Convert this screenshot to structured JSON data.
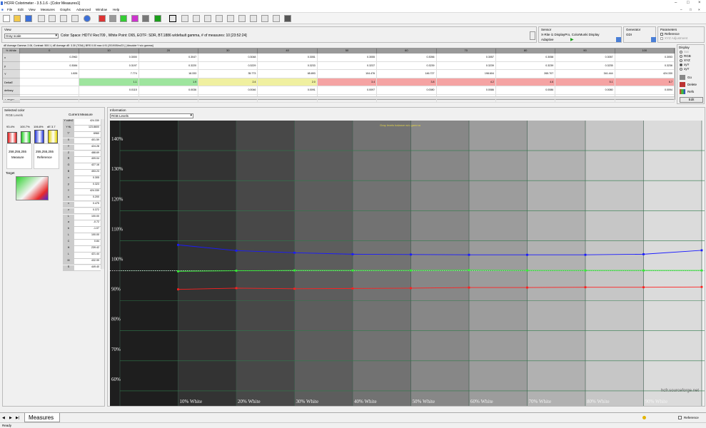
{
  "window": {
    "title": "HCFR Colorimeter - 3.5.1.6 - [Color Measures1]"
  },
  "menu": [
    "File",
    "Edit",
    "View",
    "Measures",
    "Graphs",
    "Advanced",
    "Window",
    "Help"
  ],
  "view": {
    "label": "View",
    "selected": "Gray scale",
    "color_space": "Color Space: HDTV Rec709 , White Point: D65, EOTF:  SDR, BT.1886 w/default gamma, # of measures: 10 [23:52:24]"
  },
  "sensor": {
    "label": "Sensor",
    "line1": "X-Rite i1 DisplayPro, ColorMunki Display",
    "line2": "Adaptive"
  },
  "generator": {
    "label": "Generator",
    "value": "GDI"
  },
  "parameters": {
    "label": "Parameters",
    "reference": "Reference",
    "xyz": "XYZ Adjustment"
  },
  "summary_line": "dE Average Gamma: 2.06, Contrast: 500:1 | dE Average dE: 3.30 (TGM) | BRS 0.00 max 4.91 |2019/05/xx23 | [ Absolute Y w/o gamma]",
  "table": {
    "corner": "% White",
    "columns": [
      "0",
      "10",
      "20",
      "30",
      "40",
      "50",
      "60",
      "70",
      "80",
      "90",
      "100"
    ],
    "rows": [
      {
        "label": "x",
        "values": [
          "",
          "0.2962",
          "0.3000",
          "0.3047",
          "0.3048",
          "0.3051",
          "0.3055",
          "0.3056",
          "0.3057",
          "0.3058",
          "0.3057",
          "0.3053"
        ]
      },
      {
        "label": "y",
        "values": [
          "",
          "0.3084",
          "0.3197",
          "0.3220",
          "0.3229",
          "0.3233",
          "0.3237",
          "0.3239",
          "0.3239",
          "0.3239",
          "0.3235",
          "0.3236"
        ]
      },
      {
        "label": "Y",
        "values": [
          "",
          "1.826",
          "7.774",
          "18.333",
          "35.773",
          "65.893",
          "104.476",
          "146.727",
          "198.604",
          "265.707",
          "341.444",
          "424.330"
        ]
      },
      {
        "label": "DeltaE",
        "values": [
          "",
          "",
          "1.1",
          "1.9",
          "2.4",
          "2.0",
          "3.4",
          "3.8",
          "4.2",
          "4.6",
          "5.1",
          "6.7"
        ]
      },
      {
        "label": "deltaxy",
        "values": [
          "",
          "",
          "0.0115",
          "0.0036",
          "0.0046",
          "0.0091",
          "0.0097",
          "0.0080",
          "0.0086",
          "0.0086",
          "0.0080",
          "0.0094"
        ]
      },
      {
        "label": "Y target",
        "values": [
          "",
          "1.828",
          "8.665",
          "20.865",
          "40.197",
          "67.662",
          "101.386",
          "145.779",
          "199.754",
          "263.610",
          "338.518",
          "424.330"
        ]
      }
    ],
    "deltaE_colors": [
      "",
      "#9ee59e",
      "#9ee59e",
      "#f0f0a0",
      "#f0f0a0",
      "#f5a3a3",
      "#f5a3a3",
      "#f5a3a3",
      "#f5a3a3",
      "#f5a3a3",
      "#f5a3a3"
    ]
  },
  "display_panel": {
    "label": "Display",
    "options": [
      "Sat",
      "RGB",
      "XYZ",
      "xyY",
      "xyY"
    ],
    "buttons": [
      "Go",
      "Delete",
      "Refs",
      "Edit"
    ]
  },
  "selected_color": {
    "label": "Selected color",
    "rgb_label": "RGB Levels",
    "bars": [
      {
        "value": "93.4%",
        "color": "#e31b1b",
        "height": 0.8
      },
      {
        "value": "100.7%",
        "color": "#1fcf1f",
        "height": 0.87
      },
      {
        "value": "106.8%",
        "color": "#2233d8",
        "height": 0.93
      },
      {
        "value": "dE 3.7",
        "color": "#e3d300",
        "height": 0.95
      }
    ],
    "measure": {
      "rgb": "258,255,255",
      "label": "Measure"
    },
    "reference": {
      "rgb": "255,255,255",
      "label": "Reference"
    },
    "target_label": "Target"
  },
  "current_measure": {
    "label": "Current Measure",
    "rows": [
      {
        "k": "Y cd/m2",
        "v": "424.330"
      },
      {
        "k": "Y ftL",
        "v": "123.8600"
      },
      {
        "k": "T°",
        "v": "6960"
      },
      {
        "k": "X",
        "v": "401.59"
      },
      {
        "k": "Y",
        "v": "424.28"
      },
      {
        "k": "Z",
        "v": "488.69"
      },
      {
        "k": "R",
        "v": "409.04"
      },
      {
        "k": "G",
        "v": "427.16"
      },
      {
        "k": "B",
        "v": "453.23"
      },
      {
        "k": "x",
        "v": "0.305"
      },
      {
        "k": "y",
        "v": "0.323"
      },
      {
        "k": "Y",
        "v": "424.330"
      },
      {
        "k": "u",
        "v": "0.200"
      },
      {
        "k": "v",
        "v": "0.475"
      },
      {
        "k": "z",
        "v": "0.372"
      },
      {
        "k": "L",
        "v": "100.00"
      },
      {
        "k": "a",
        "v": "-0.72"
      },
      {
        "k": "b",
        "v": "-1.07"
      },
      {
        "k": "L",
        "v": "100.00"
      },
      {
        "k": "C",
        "v": "0.84"
      },
      {
        "k": "H",
        "v": "239.42"
      },
      {
        "k": "L",
        "v": "421.44"
      },
      {
        "k": "M",
        "v": "432.99"
      },
      {
        "k": "S",
        "v": "449.40"
      }
    ]
  },
  "information": {
    "label": "Information",
    "selected": "RGB Levels"
  },
  "chart_data": {
    "type": "line",
    "title": "Gray levels balance w/o gamma",
    "categories": [
      "10% White",
      "20% White",
      "30% White",
      "40% White",
      "50% White",
      "60% White",
      "70% White",
      "80% White",
      "90% White",
      "100% White"
    ],
    "y_ticks": [
      "60%",
      "70%",
      "80%",
      "90%",
      "100%",
      "110%",
      "120%",
      "130%",
      "140%"
    ],
    "ylim": [
      55,
      150
    ],
    "series": [
      {
        "name": "Blue",
        "color": "#1a1aff",
        "values": [
          108.6,
          106.7,
          106.0,
          105.5,
          105.4,
          105.3,
          105.3,
          105.3,
          105.5,
          106.8
        ]
      },
      {
        "name": "Green",
        "color": "#33ee33",
        "values": [
          99.8,
          100.0,
          100.1,
          100.1,
          100.1,
          100.2,
          100.1,
          100.1,
          100.1,
          100.1
        ]
      },
      {
        "name": "Red",
        "color": "#ff2020",
        "values": [
          93.8,
          94.2,
          94.0,
          94.1,
          94.2,
          94.4,
          94.4,
          94.5,
          94.5,
          94.6
        ]
      }
    ],
    "reference_line": 100,
    "watermark": "hcfr.sourceforge.net"
  },
  "bottom": {
    "tab": "Measures",
    "reference": "Reference"
  },
  "status": {
    "text": "Ready"
  }
}
